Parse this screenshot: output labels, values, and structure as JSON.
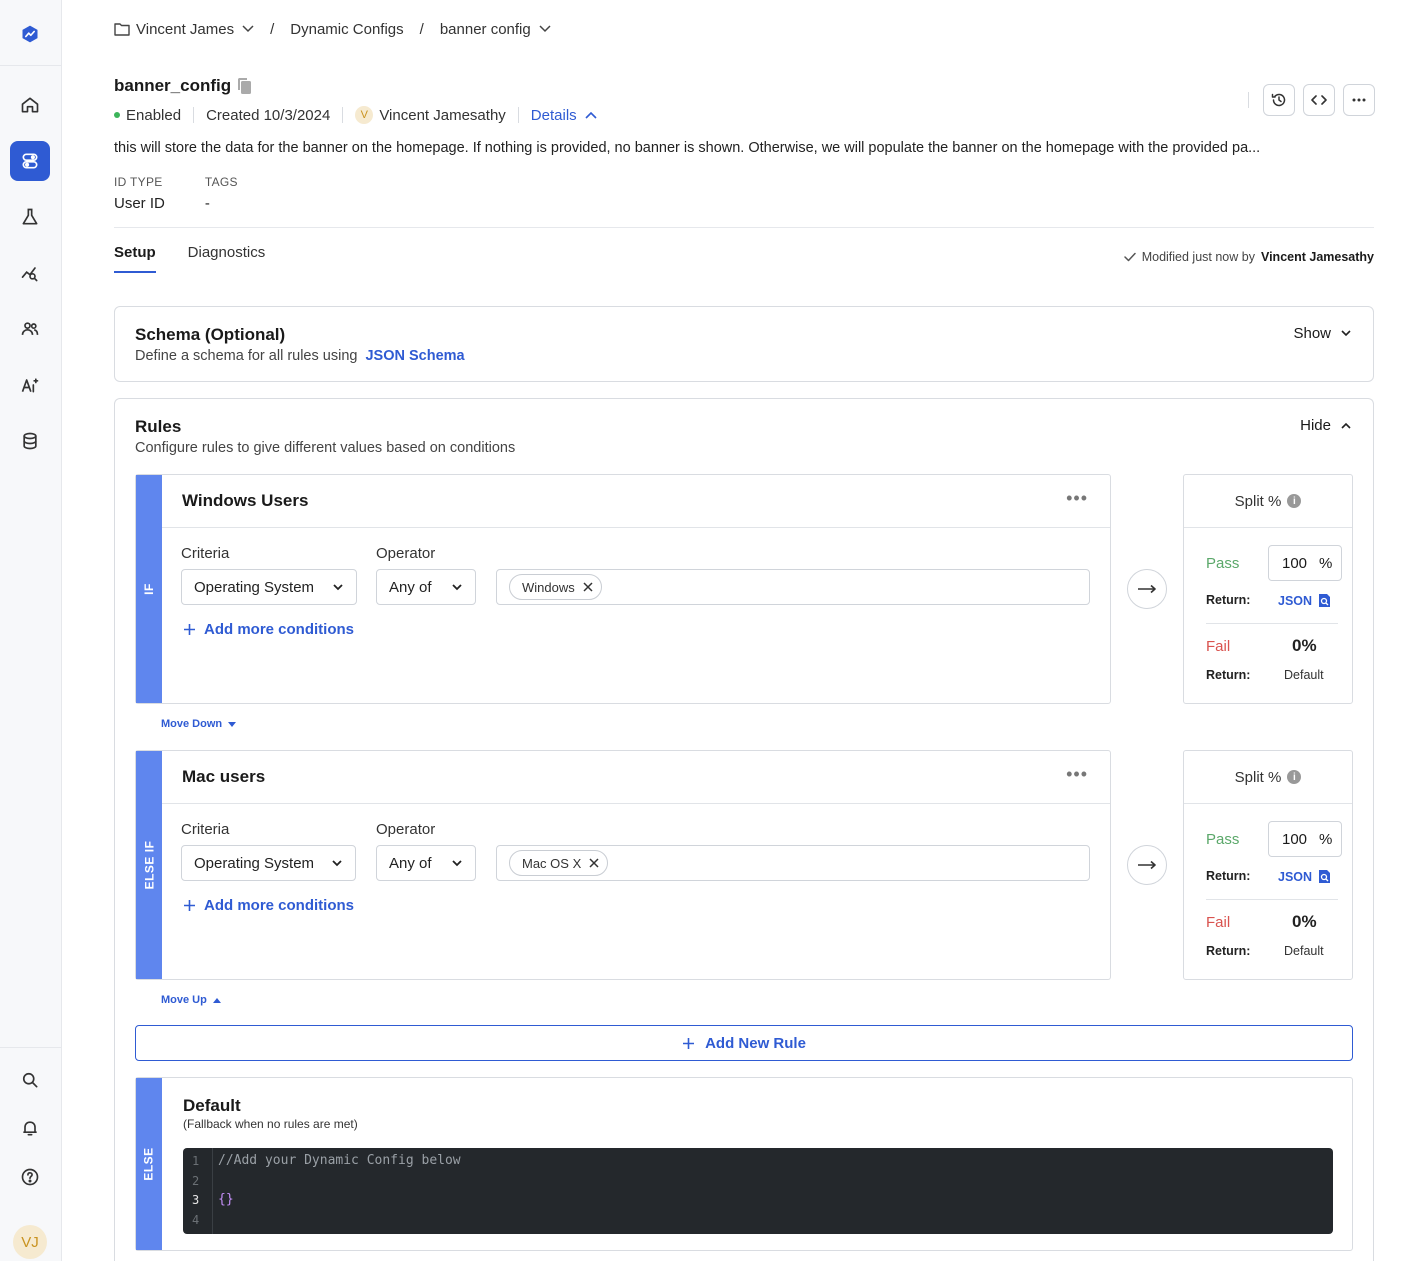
{
  "sidebar": {
    "icons": [
      "logo-icon",
      "home-icon",
      "dynamic-configs-icon",
      "experiments-icon",
      "analytics-icon",
      "users-icon",
      "ai-icon",
      "database-icon",
      "search-icon",
      "bell-icon",
      "help-icon"
    ],
    "avatar": "VJ"
  },
  "breadcrumb": {
    "project": "Vincent James",
    "section": "Dynamic Configs",
    "item": "banner config",
    "separator": "/"
  },
  "config": {
    "name": "banner_config",
    "status": "Enabled",
    "created": "Created 10/3/2024",
    "owner_initial": "V",
    "owner": "Vincent Jamesathy",
    "details_label": "Details",
    "description": "this will store the data for the banner on the homepage. If nothing is provided, no banner is shown. Otherwise, we will populate the banner on the homepage with the provided pa...",
    "id_type_label": "ID TYPE",
    "id_type": "User ID",
    "tags_label": "TAGS",
    "tags": "-"
  },
  "tabs": [
    {
      "label": "Setup",
      "active": true
    },
    {
      "label": "Diagnostics",
      "active": false
    }
  ],
  "modified": {
    "text": "Modified just now by",
    "user": "Vincent Jamesathy"
  },
  "schema": {
    "title": "Schema (Optional)",
    "subtitle": "Define a schema for all rules using",
    "link": "JSON Schema",
    "toggle": "Show"
  },
  "rules_section": {
    "title": "Rules",
    "subtitle": "Configure rules to give different values based on conditions",
    "toggle": "Hide",
    "rules": [
      {
        "condition": "IF",
        "name": "Windows Users",
        "criteria_label": "Criteria",
        "criteria": "Operating System",
        "operator_label": "Operator",
        "operator": "Any of",
        "value": "Windows",
        "add_conditions": "Add more conditions",
        "split_label": "Split %",
        "pass_label": "Pass",
        "pass_pct": "100",
        "pct_sign": "%",
        "return_label": "Return:",
        "pass_return": "JSON",
        "fail_label": "Fail",
        "fail_pct": "0%",
        "fail_return": "Default",
        "move": "Move Down"
      },
      {
        "condition": "ELSE IF",
        "name": "Mac users",
        "criteria_label": "Criteria",
        "criteria": "Operating System",
        "operator_label": "Operator",
        "operator": "Any of",
        "value": "Mac OS X",
        "add_conditions": "Add more conditions",
        "split_label": "Split %",
        "pass_label": "Pass",
        "pass_pct": "100",
        "pct_sign": "%",
        "return_label": "Return:",
        "pass_return": "JSON",
        "fail_label": "Fail",
        "fail_pct": "0%",
        "fail_return": "Default",
        "move": "Move Up"
      }
    ],
    "add_rule": "Add New Rule",
    "default": {
      "condition": "ELSE",
      "title": "Default",
      "subtitle": "(Fallback when no rules are met)",
      "line_numbers": [
        "1",
        "2",
        "3",
        "4"
      ],
      "code_line1": "//Add your Dynamic Config below",
      "code_line3": "{}"
    }
  },
  "colors": {
    "accent": "#2f5bd3",
    "rule_strip": "#5f86ee",
    "pass": "#5ba86a",
    "fail": "#d9534f",
    "editor_bg": "#24282c"
  }
}
